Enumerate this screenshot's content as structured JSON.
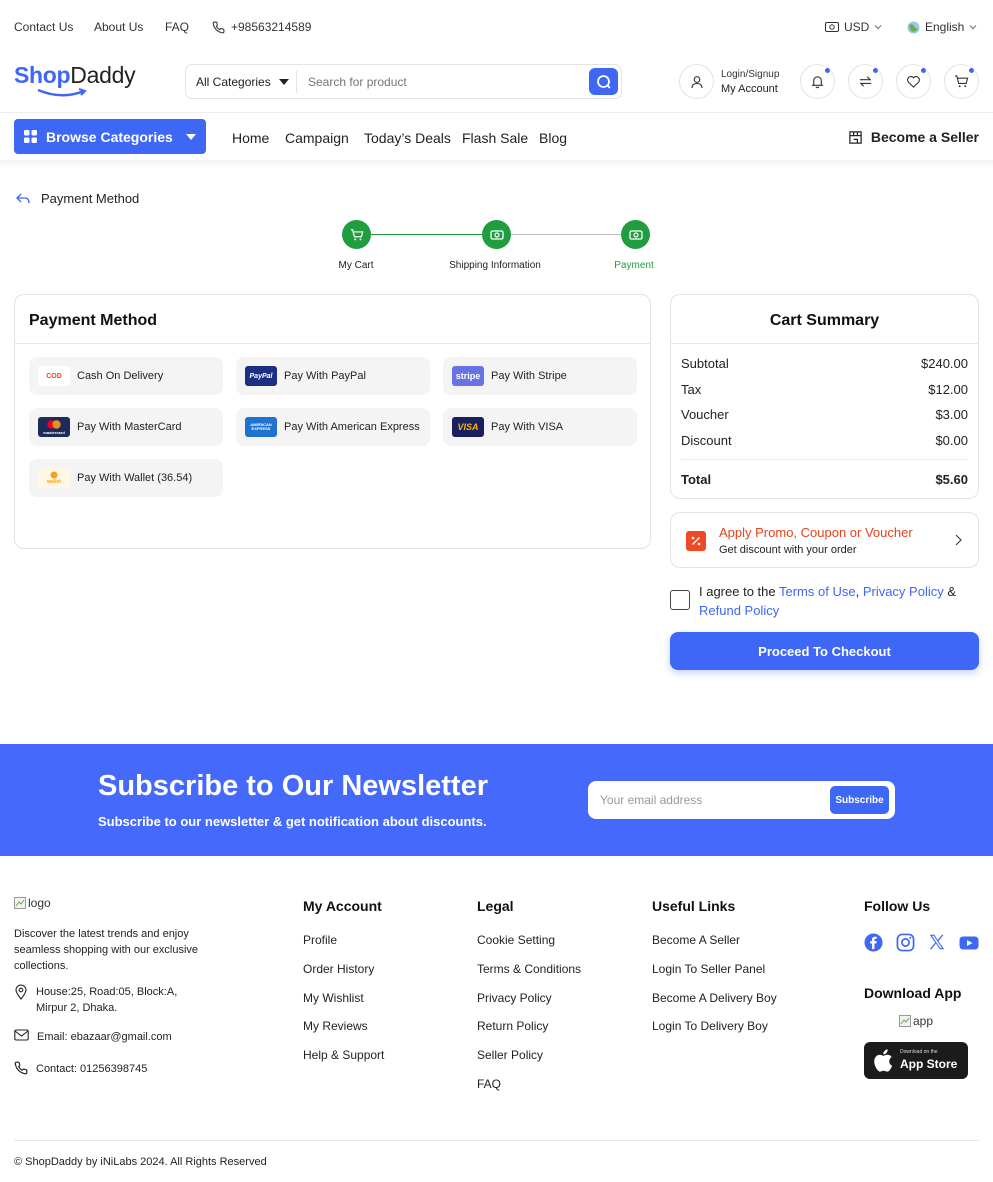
{
  "topbar": {
    "contact": "Contact Us",
    "about": "About Us",
    "faq": "FAQ",
    "phone": "+98563214589",
    "currency": "USD",
    "language": "English"
  },
  "header": {
    "logo_part1": "Shop",
    "logo_part2": "Daddy",
    "category_select": "All Categories",
    "search_placeholder": "Search for product",
    "login_label": "Login/Signup",
    "account_label": "My Account"
  },
  "nav": {
    "browse": "Browse Categories",
    "links": [
      "Home",
      "Campaign",
      "Today’s Deals",
      "Flash Sale",
      "Blog"
    ],
    "seller": "Become a Seller"
  },
  "breadcrumb": {
    "title": "Payment Method"
  },
  "steps": [
    {
      "label": "My Cart",
      "active": false
    },
    {
      "label": "Shipping Information",
      "active": false
    },
    {
      "label": "Payment",
      "active": true
    }
  ],
  "payment": {
    "title": "Payment Method",
    "options": [
      {
        "label": "Cash On Delivery",
        "icon": "cod-icon"
      },
      {
        "label": "Pay With PayPal",
        "icon": "paypal-icon"
      },
      {
        "label": "Pay With Stripe",
        "icon": "stripe-icon"
      },
      {
        "label": "Pay With MasterCard",
        "icon": "mastercard-icon"
      },
      {
        "label": "Pay With American Express",
        "icon": "amex-icon"
      },
      {
        "label": "Pay With VISA",
        "icon": "visa-icon"
      },
      {
        "label": "Pay With Wallet (36.54)",
        "icon": "wallet-icon"
      }
    ],
    "icon_text": {
      "cod": "COD",
      "paypal": "PayPal",
      "stripe": "stripe",
      "mastercard": "mastercard",
      "amex": "AMERICAN EXPRESS",
      "visa": "VISA",
      "wallet": "wallet"
    }
  },
  "summary": {
    "title": "Cart Summary",
    "rows": [
      {
        "label": "Subtotal",
        "value": "$240.00"
      },
      {
        "label": "Tax",
        "value": "$12.00"
      },
      {
        "label": "Voucher",
        "value": "$3.00"
      },
      {
        "label": "Discount",
        "value": "$0.00"
      }
    ],
    "total_label": "Total",
    "total_value": "$5.60"
  },
  "promo": {
    "title": "Apply Promo, Coupon or Voucher",
    "subtitle": "Get discount with your order"
  },
  "agree": {
    "prefix": "I agree to the ",
    "terms": "Terms of Use",
    "comma": ", ",
    "privacy": "Privacy Policy",
    "amp": " & ",
    "refund": "Refund Policy"
  },
  "checkout": "Proceed To Checkout",
  "newsletter": {
    "title": "Subscribe to Our Newsletter",
    "subtitle": "Subscribe to our newsletter & get notification about discounts.",
    "placeholder": "Your email address",
    "button": "Subscribe"
  },
  "footer": {
    "logo_alt": "logo",
    "description": "Discover the latest trends and enjoy seamless shopping with our exclusive collections.",
    "address": "House:25, Road:05, Block:A, Mirpur 2, Dhaka.",
    "email": "Email: ebazaar@gmail.com",
    "contact": "Contact: 01256398745",
    "account_title": "My Account",
    "account_links": [
      "Profile",
      "Order History",
      "My Wishlist",
      "My Reviews",
      "Help & Support"
    ],
    "legal_title": "Legal",
    "legal_links": [
      "Cookie Setting",
      "Terms & Conditions",
      "Privacy Policy",
      "Return Policy",
      "Seller Policy",
      "FAQ"
    ],
    "useful_title": "Useful Links",
    "useful_links": [
      "Become A Seller",
      "Login To Seller Panel",
      "Become A Delivery Boy",
      "Login To Delivery Boy"
    ],
    "follow_title": "Follow Us",
    "download_title": "Download App",
    "app_alt": "app",
    "appstore_small": "Download on the",
    "appstore_big": "App Store",
    "copyright": "© ShopDaddy by iNiLabs 2024. All Rights Reserved"
  },
  "colors": {
    "accent": "#3e67f5",
    "success": "#1f9d3f",
    "promo": "#e8421a",
    "newsletter_bg": "#4469fb"
  }
}
